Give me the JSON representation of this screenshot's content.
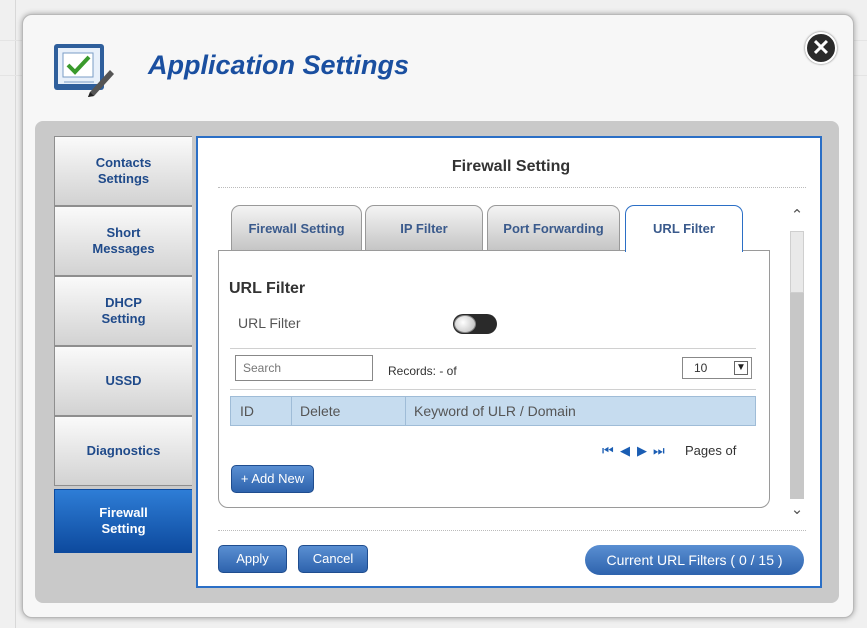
{
  "header": {
    "title": "Application Settings",
    "close_icon": "close-icon",
    "app_icon": "settings-checklist-icon"
  },
  "sidebar": {
    "items": [
      {
        "label": "Contacts\nSettings",
        "active": false
      },
      {
        "label": "Short\nMessages",
        "active": false
      },
      {
        "label": "DHCP\nSetting",
        "active": false
      },
      {
        "label": "USSD",
        "active": false
      },
      {
        "label": "Diagnostics",
        "active": false
      },
      {
        "label": "Firewall\nSetting",
        "active": true
      }
    ]
  },
  "panel": {
    "title": "Firewall Setting"
  },
  "tabs": [
    {
      "label": "Firewall Setting",
      "active": false
    },
    {
      "label": "IP Filter",
      "active": false
    },
    {
      "label": "Port Forwarding",
      "active": false
    },
    {
      "label": "URL Filter",
      "active": true
    }
  ],
  "url_filter": {
    "section_title": "URL Filter",
    "toggle_label": "URL Filter",
    "toggle_on": false,
    "search_placeholder": "Search",
    "records_text": "Records: - of",
    "page_size": "10",
    "columns": [
      "ID",
      "Delete",
      "Keyword of ULR / Domain"
    ],
    "rows": [],
    "pages_text": "Pages of",
    "add_button": "+ Add New"
  },
  "footer": {
    "apply_label": "Apply",
    "cancel_label": "Cancel",
    "status_text": "Current URL Filters ( 0 / 15 )"
  },
  "colors": {
    "accent": "#2b6fc6",
    "title": "#1a4fa0",
    "header_row": "#c6dcef"
  }
}
